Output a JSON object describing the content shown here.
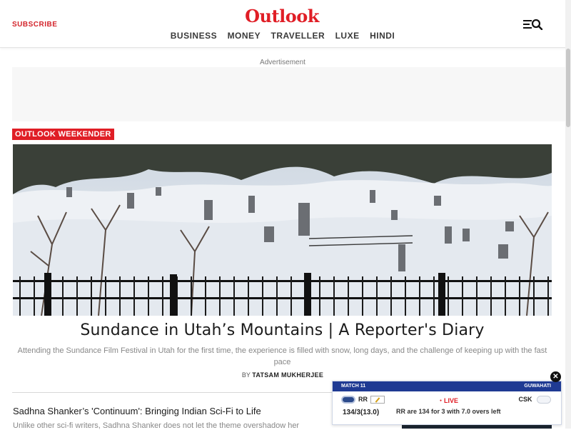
{
  "header": {
    "subscribe_label": "SUBSCRIBE",
    "logo_text": "Outlook",
    "nav": [
      "BUSINESS",
      "MONEY",
      "TRAVELLER",
      "LUXE",
      "HINDI"
    ],
    "menu_icon": "menu-search-icon"
  },
  "ad": {
    "label": "Advertisement"
  },
  "featured": {
    "tag": "OUTLOOK WEEKENDER",
    "image_icon": "snowy-cemetery-photo",
    "title": "Sundance in Utah’s Mountains | A Reporter's Diary",
    "summary": "Attending the Sundance Film Festival in Utah for the first time, the experience is filled with snow, long days, and the challenge of keeping up with the fast pace",
    "byline_prefix": "BY",
    "author": "TATSAM MUKHERJEE"
  },
  "story2": {
    "title": "Sadhna Shanker’s 'Continuum': Bringing Indian Sci-Fi to Life",
    "summary": "Unlike other sci-fi writers, Sadhna Shanker does not let the theme overshadow her"
  },
  "live_score": {
    "match": "MATCH 11",
    "venue": "GUWAHATI",
    "team_a": "RR",
    "team_b": "CSK",
    "live_label": "LIVE",
    "team_a_score": "134/3(13.0)",
    "status": "RR are 134 for 3 with 7.0 overs left",
    "close_symbol": "✕"
  },
  "colors": {
    "brand_red": "#e01e26",
    "score_header": "#1f3a93"
  }
}
